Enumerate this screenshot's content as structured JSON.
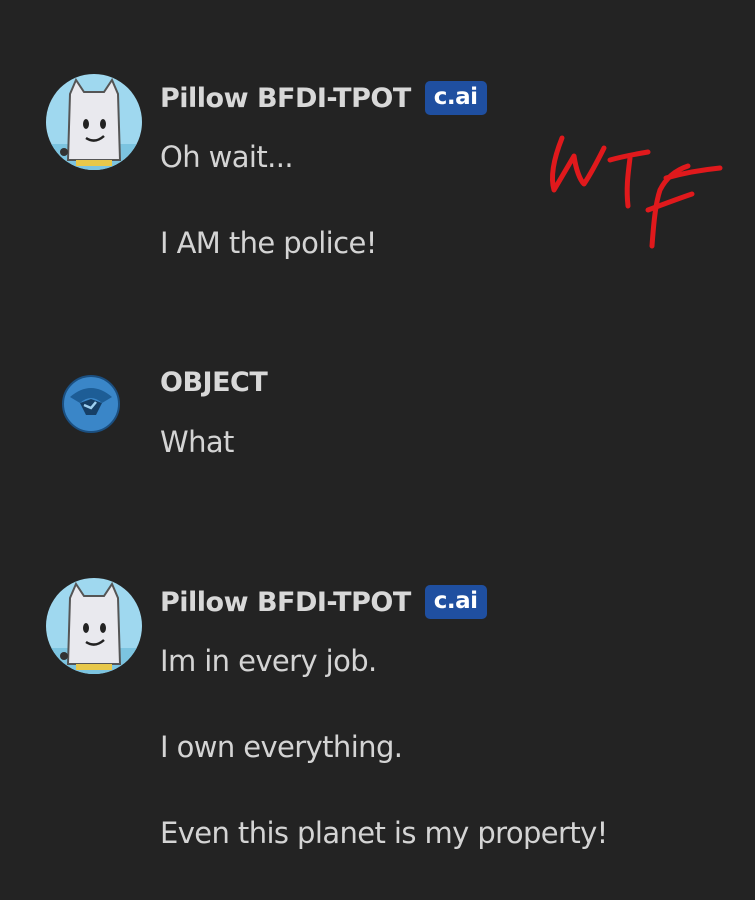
{
  "messages": [
    {
      "author": "Pillow BFDI-TPOT",
      "badge": "c.ai",
      "lines": [
        "Oh wait...",
        "I AM the police!"
      ]
    },
    {
      "author": "OBJECT",
      "lines": [
        "What"
      ]
    },
    {
      "author": "Pillow BFDI-TPOT",
      "badge": "c.ai",
      "lines": [
        "Im in every job.",
        "I own everything.",
        "Even this planet is my property!"
      ]
    }
  ],
  "annotation": {
    "text": "WTF",
    "color": "#e0191c"
  },
  "colors": {
    "background": "#232323",
    "badge": "#1f4fa0",
    "text": "#d4d4d4",
    "user_avatar": "#3a8ad0"
  }
}
